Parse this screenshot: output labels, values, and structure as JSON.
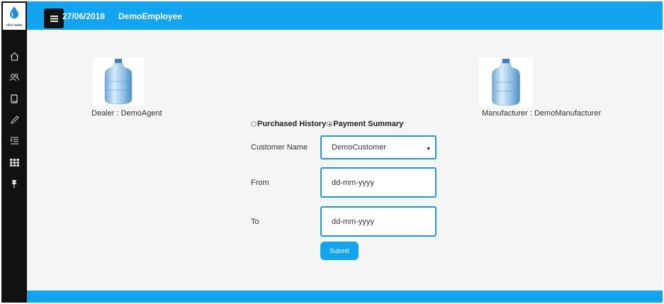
{
  "brand": {
    "logo_text": "click water"
  },
  "header": {
    "date": "27/06/2018",
    "user": "DemoEmployee"
  },
  "sidebar": {
    "items": [
      {
        "icon": "home-icon"
      },
      {
        "icon": "users-icon"
      },
      {
        "icon": "book-icon"
      },
      {
        "icon": "pencil-icon"
      },
      {
        "icon": "list-indent-icon"
      },
      {
        "icon": "grid-icon"
      },
      {
        "icon": "pin-icon"
      }
    ]
  },
  "dealer": {
    "label": "Dealer : DemoAgent"
  },
  "manufacturer": {
    "label": "Manufacturer : DemoManufacturer"
  },
  "report_type": {
    "options": [
      {
        "label": "Purchased History",
        "checked": false
      },
      {
        "label": "Payment Summary",
        "checked": true
      }
    ]
  },
  "form": {
    "customer_label": "Customer Name",
    "customer_value": "DemoCustomer",
    "from_label": "From",
    "from_placeholder": "dd-mm-yyyy",
    "to_label": "To",
    "to_placeholder": "dd-mm-yyyy",
    "submit_label": "Submit"
  },
  "colors": {
    "accent": "#12a4ef",
    "sidebar": "#111111",
    "background": "#f5f5f5"
  }
}
